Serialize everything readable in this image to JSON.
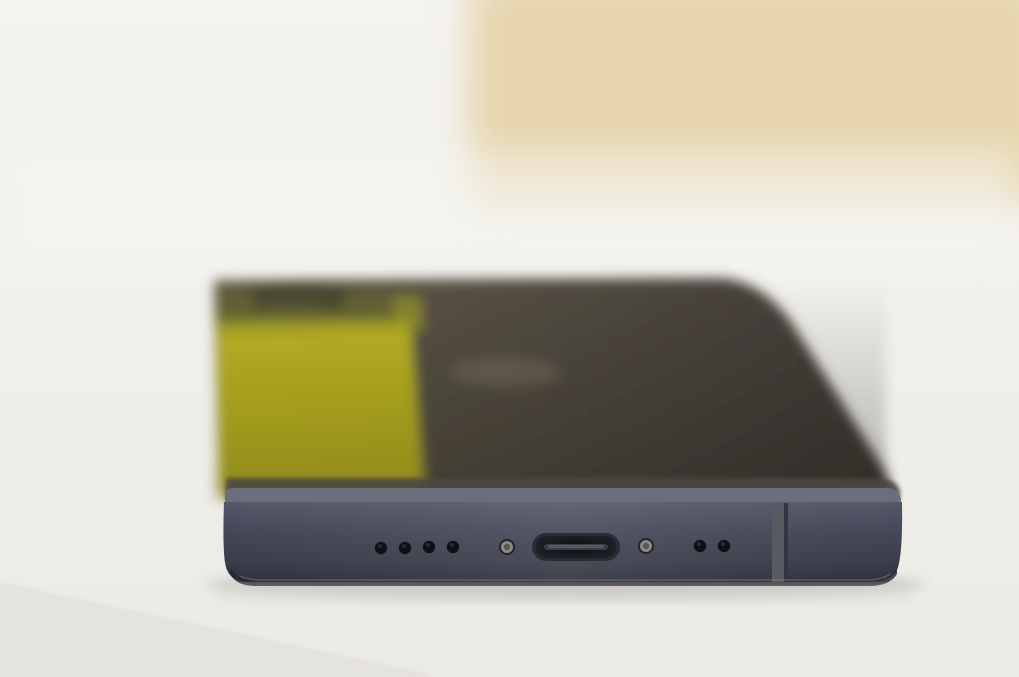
{
  "scene": {
    "subject": "smartphone-bottom-edge",
    "colors": {
      "background": "#f3f2ee",
      "tabletop": "#efeee9",
      "phone_frame": "#3f4150",
      "phone_frame_highlight": "#5d6072",
      "glass_dark": "#4a443d",
      "glass_reflection_yellow": "#c7c02a",
      "background_object": "#e7d7b4"
    },
    "icons": {
      "speaker_left": "speaker-grille-icon",
      "usb_port": "usb-c-port-icon",
      "screw_left": "screw-icon",
      "screw_right": "screw-icon",
      "mic": "microphone-holes-icon"
    }
  }
}
